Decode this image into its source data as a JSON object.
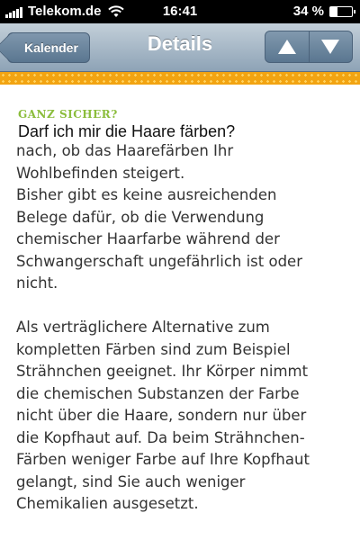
{
  "status_bar": {
    "carrier": "Telekom.de",
    "time": "16:41",
    "battery_text": "34 %",
    "battery_level": 0.34
  },
  "nav": {
    "back_label": "Kalender",
    "title": "Details",
    "up_icon": "arrow-up-icon",
    "down_icon": "arrow-down-icon"
  },
  "banner_color": "#f2a412",
  "article": {
    "kicker": "GANZ SICHER?",
    "question": "Darf ich mir die Haare färben?",
    "lines_partial": [
      "nach, ob das Haarefärben Ihr",
      "Wohlbefinden steigert."
    ],
    "lines_p1": [
      "Bisher gibt es keine ausreichenden",
      "Belege dafür, ob die Verwendung",
      "chemischer Haarfarbe während der",
      "Schwangerschaft ungefährlich ist oder",
      "nicht."
    ],
    "lines_p2": [
      "Als verträglichere Alternative zum",
      "kompletten Färben sind zum Beispiel",
      "Strähnchen geeignet. Ihr Körper nimmt",
      "die chemischen Substanzen der Farbe",
      "nicht über die Haare, sondern nur über",
      "die Kopfhaut auf. Da beim Strähnchen-",
      "Färben weniger Farbe auf Ihre Kopfhaut",
      "gelangt, sind Sie auch weniger",
      "Chemikalien ausgesetzt."
    ]
  }
}
